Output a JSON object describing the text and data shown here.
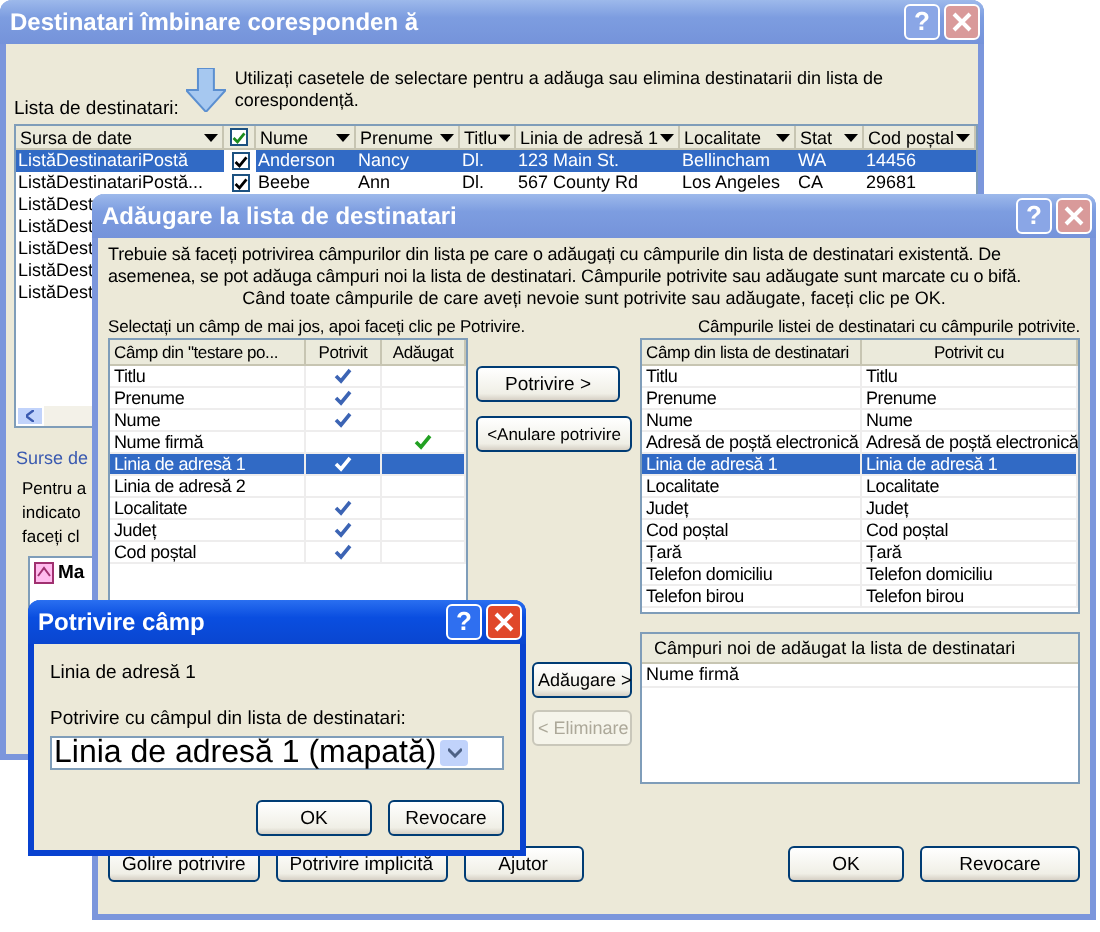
{
  "recipients_window": {
    "title": "Destinatari îmbinare coresponden ă",
    "active": false,
    "help_button": "?",
    "list_label": "Lista de destinatari:",
    "hint": "Utilizați casetele de selectare pentru a adăuga sau elimina destinatarii din lista de corespondență.",
    "select_all": {
      "checked": true
    },
    "columns": [
      "Sursa de date",
      "Nume",
      "Prenume",
      "Titlu",
      "Linia de adresă 1",
      "Localitate",
      "Stat",
      "Cod poștal"
    ],
    "rows": [
      {
        "selected": true,
        "checked": true,
        "cells": [
          "ListăDestinatariPostă",
          "Anderson",
          "Nancy",
          "Dl.",
          "123 Main St.",
          "Bellincham",
          "WA",
          "14456"
        ]
      },
      {
        "selected": false,
        "checked": true,
        "cells": [
          "ListăDestinatariPostă...",
          "Beebe",
          "Ann",
          "Dl.",
          "567 County Rd",
          "Los Angeles",
          "CA",
          "29681"
        ]
      },
      {
        "selected": false,
        "cells": [
          "ListăDest"
        ]
      },
      {
        "selected": false,
        "cells": [
          "ListăDest"
        ]
      },
      {
        "selected": false,
        "cells": [
          "ListăDest"
        ]
      },
      {
        "selected": false,
        "cells": [
          "ListăDest"
        ]
      },
      {
        "selected": false,
        "cells": [
          "ListăDest"
        ]
      }
    ],
    "sources_link": "Surse de",
    "notes": [
      "Pentru a",
      "indicato",
      "faceți cl"
    ],
    "source_item": "Ma"
  },
  "add_window": {
    "title": "Adăugare la lista de destinatari",
    "active": false,
    "help_button": "?",
    "intro": "Trebuie să faceți potrivirea câmpurilor din lista pe care o adăugați cu câmpurile din lista de destinatari existentă. De asemenea, se pot adăuga câmpuri noi la lista de destinatari. Câmpurile potrivite sau adăugate sunt marcate cu o bifă.",
    "instruction": "Când toate câmpurile de care aveți nevoie sunt potrivite sau adăugate, faceți clic pe OK.",
    "source_label": "Selectați un câmp de mai jos, apoi faceți clic pe Potrivire.",
    "target_label": "Câmpurile listei de destinatari cu câmpurile potrivite.",
    "source_columns": [
      "Câmp din \"testare po...",
      "Potrivit",
      "Adăugat"
    ],
    "source_fields": [
      {
        "name": "Titlu",
        "matched": true,
        "added": false,
        "selected": false
      },
      {
        "name": "Prenume",
        "matched": true,
        "added": false,
        "selected": false
      },
      {
        "name": "Nume",
        "matched": true,
        "added": false,
        "selected": false
      },
      {
        "name": "Nume firmă",
        "matched": false,
        "added": true,
        "selected": false
      },
      {
        "name": "Linia de adresă 1",
        "matched": true,
        "added": false,
        "selected": true
      },
      {
        "name": "Linia de adresă 2",
        "matched": false,
        "added": false,
        "selected": false
      },
      {
        "name": "Localitate",
        "matched": true,
        "added": false,
        "selected": false
      },
      {
        "name": "Județ",
        "matched": true,
        "added": false,
        "selected": false
      },
      {
        "name": "Cod poștal",
        "matched": true,
        "added": false,
        "selected": false
      }
    ],
    "match_button": "Potrivire >",
    "unmatch_button": "<Anulare potrivire",
    "add_button": "Adăugare >",
    "remove_button": {
      "label": "< Eliminare",
      "disabled": true
    },
    "target_columns": [
      "Câmp din lista de destinatari",
      "Potrivit cu"
    ],
    "target_fields": [
      {
        "field": "Titlu",
        "matched_with": "Titlu",
        "selected": false
      },
      {
        "field": "Prenume",
        "matched_with": "Prenume",
        "selected": false
      },
      {
        "field": "Nume",
        "matched_with": "Nume",
        "selected": false
      },
      {
        "field": "Adresă de poștă electronică",
        "matched_with": "Adresă de poștă electronică",
        "selected": false
      },
      {
        "field": "Linia de adresă 1",
        "matched_with": "Linia de adresă 1",
        "selected": true
      },
      {
        "field": "Localitate",
        "matched_with": "Localitate",
        "selected": false
      },
      {
        "field": "Județ",
        "matched_with": "Județ",
        "selected": false
      },
      {
        "field": "Cod poștal",
        "matched_with": "Cod poștal",
        "selected": false
      },
      {
        "field": "Țară",
        "matched_with": "Țară",
        "selected": false
      },
      {
        "field": "Telefon domiciliu",
        "matched_with": "Telefon domiciliu",
        "selected": false
      },
      {
        "field": "Telefon birou",
        "matched_with": "Telefon birou",
        "selected": false
      }
    ],
    "new_fields_header": "Câmpuri noi de adăugat la lista de destinatari",
    "new_fields": [
      "Nume firmă"
    ],
    "left_buttons": [
      "Golire potrivire",
      "Potrivire implicită",
      "Ajutor"
    ],
    "right_buttons": [
      "OK",
      "Revocare"
    ]
  },
  "match_dialog": {
    "title": "Potrivire câmp",
    "active": true,
    "help_button": "?",
    "field": "Linia de adresă 1",
    "select_label": "Potrivire cu câmpul din lista de destinatari:",
    "select_value": "Linia de adresă 1 (mapată)",
    "buttons": [
      "OK",
      "Revocare"
    ]
  }
}
